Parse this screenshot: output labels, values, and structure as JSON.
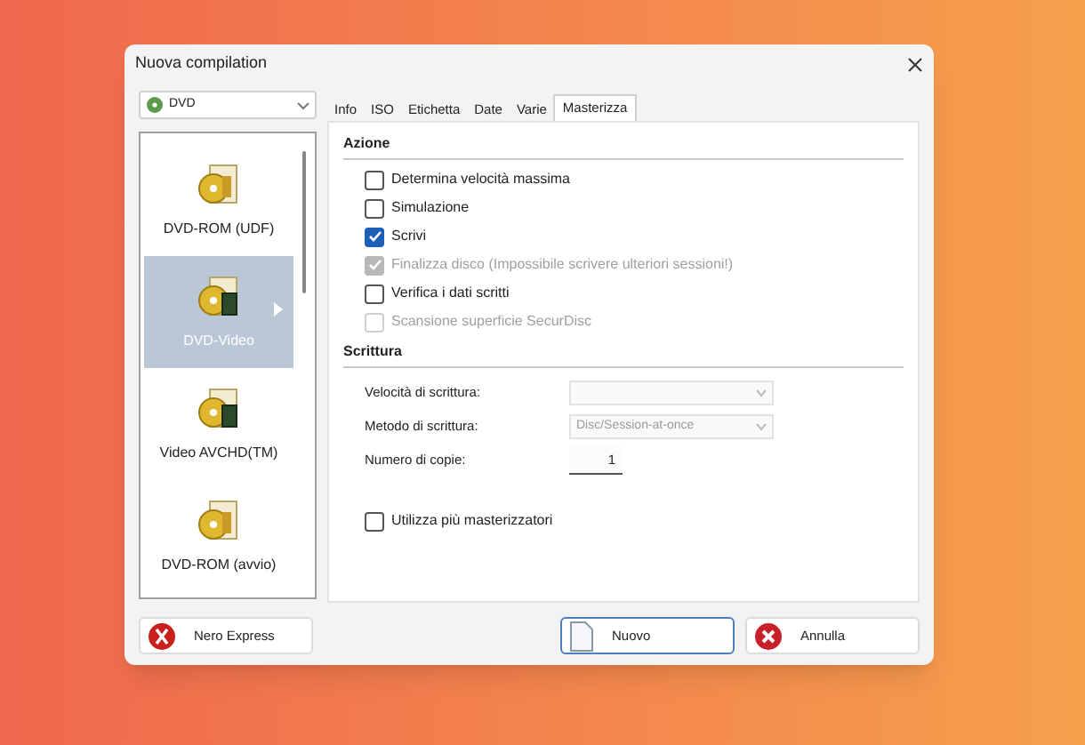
{
  "window": {
    "title": "Nuova compilation"
  },
  "disc_select": {
    "value": "DVD"
  },
  "compilations": [
    {
      "label": "DVD-ROM (UDF)",
      "selected": false
    },
    {
      "label": "DVD-Video",
      "selected": true
    },
    {
      "label": "Video AVCHD(TM)",
      "selected": false
    },
    {
      "label": "DVD-ROM (avvio)",
      "selected": false
    }
  ],
  "tabs": [
    {
      "label": "Info",
      "selected": false
    },
    {
      "label": "ISO",
      "selected": false
    },
    {
      "label": "Etichetta",
      "selected": false
    },
    {
      "label": "Date",
      "selected": false
    },
    {
      "label": "Varie",
      "selected": false
    },
    {
      "label": "Masterizza",
      "selected": true
    }
  ],
  "azione": {
    "title": "Azione",
    "options": [
      {
        "label": "Determina velocità massima",
        "checked": false,
        "disabled": false
      },
      {
        "label": "Simulazione",
        "checked": false,
        "disabled": false
      },
      {
        "label": "Scrivi",
        "checked": true,
        "disabled": false
      },
      {
        "label": "Finalizza disco (Impossibile scrivere ulteriori sessioni!)",
        "checked": true,
        "disabled": true
      },
      {
        "label": "Verifica i dati scritti",
        "checked": false,
        "disabled": false
      },
      {
        "label": "Scansione superficie SecurDisc",
        "checked": false,
        "disabled": true
      }
    ]
  },
  "scrittura": {
    "title": "Scrittura",
    "fields": [
      {
        "kind": "select",
        "label": "Velocità di scrittura:",
        "disabled": true
      },
      {
        "kind": "select",
        "label": "Metodo di scrittura:",
        "value": "Disc/Session-at-once",
        "disabled": true
      },
      {
        "kind": "number",
        "label": "Numero di copie:",
        "value": "1",
        "disabled": false
      }
    ],
    "extra_option": {
      "label": "Utilizza più masterizzatori",
      "checked": false,
      "disabled": false
    }
  },
  "buttons": [
    {
      "kind": "express",
      "label": "Nero Express",
      "default": false
    },
    {
      "kind": "new",
      "label": "Nuovo",
      "default": true
    },
    {
      "kind": "cancel",
      "label": "Annulla",
      "default": false
    }
  ]
}
